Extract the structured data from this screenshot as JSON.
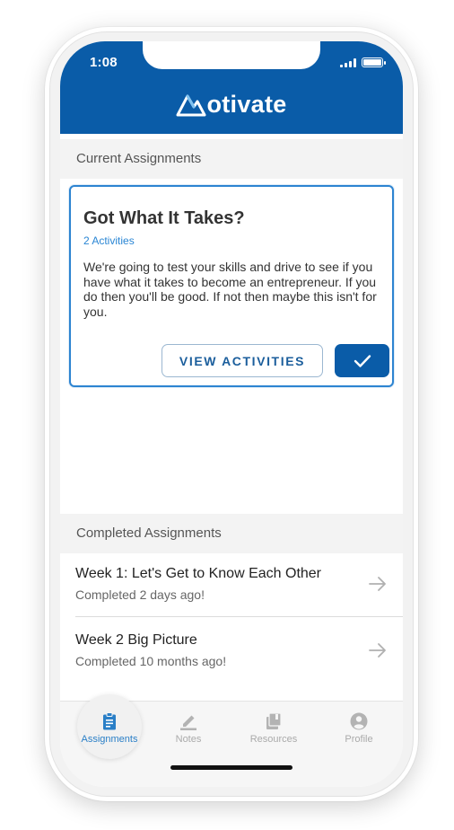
{
  "status_bar": {
    "time": "1:08"
  },
  "app": {
    "brand_text": "otivate",
    "brand_color": "#0a5ca8",
    "accent_color": "#2d84d1"
  },
  "current": {
    "section_title": "Current Assignments",
    "card": {
      "title": "Got What It Takes?",
      "activities": "2 Activities",
      "description": "We're going to test your skills and drive to see if you have what it takes to become an entrepreneur. If you do then you'll be good. If not then maybe this isn't for you.",
      "view_label": "VIEW ACTIVITIES",
      "complete_icon": "checkmark-icon"
    }
  },
  "completed": {
    "section_title": "Completed Assignments",
    "items": [
      {
        "title": "Week 1: Let's Get to Know Each Other",
        "subtitle": "Completed 2 days ago!"
      },
      {
        "title": "Week 2 Big Picture",
        "subtitle": "Completed 10 months ago!"
      }
    ]
  },
  "tabs": [
    {
      "label": "Assignments",
      "icon": "clipboard-icon",
      "active": true
    },
    {
      "label": "Notes",
      "icon": "pencil-icon",
      "active": false
    },
    {
      "label": "Resources",
      "icon": "library-icon",
      "active": false
    },
    {
      "label": "Profile",
      "icon": "person-circle-icon",
      "active": false
    }
  ]
}
